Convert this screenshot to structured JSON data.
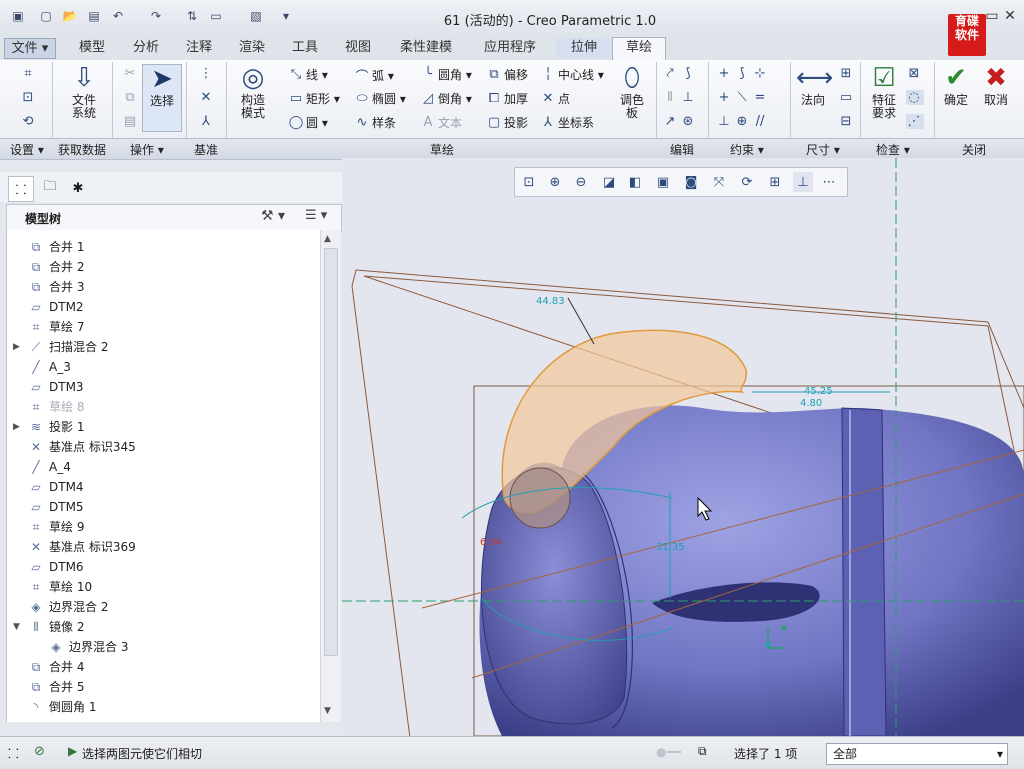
{
  "window": {
    "title": "61 (活动的) - Creo Parametric 1.0"
  },
  "logo": {
    "line1": "育碟",
    "line2": "软件"
  },
  "tabs": {
    "file": "文件",
    "items": [
      "模型",
      "分析",
      "注释",
      "渲染",
      "工具",
      "视图",
      "柔性建模",
      "应用程序"
    ],
    "extrude": "拉伸",
    "sketch": "草绘"
  },
  "ribbon": {
    "file_system": "文件\n系统",
    "select": "选择",
    "construct": "构造\n模式",
    "line": "线",
    "rectangle": "矩形",
    "circle": "圆",
    "arc": "弧",
    "ellipse": "椭圆",
    "spline": "样条",
    "fillet": "圆角",
    "chamfer": "倒角",
    "text": "文本",
    "offset": "偏移",
    "thicken": "加厚",
    "project": "投影",
    "centerline": "中心线",
    "point": "点",
    "coordsys": "坐标系",
    "palette": "调色\n板",
    "normal": "法向",
    "feature_req": "特征\n要求",
    "ok": "确定",
    "cancel": "取消"
  },
  "groups": {
    "settings": "设置",
    "get_data": "获取数据",
    "operations": "操作",
    "datum": "基准",
    "sketching": "草绘",
    "editing": "编辑",
    "constrain": "约束",
    "dimension": "尺寸",
    "inspect": "检查",
    "close": "关闭"
  },
  "model_tree": {
    "title": "模型树",
    "items": [
      {
        "label": "合并 1",
        "icon": "merge-icon"
      },
      {
        "label": "合并 2",
        "icon": "merge-icon"
      },
      {
        "label": "合并 3",
        "icon": "merge-icon"
      },
      {
        "label": "DTM2",
        "icon": "datum-plane-icon"
      },
      {
        "label": "草绘 7",
        "icon": "sketch-icon"
      },
      {
        "label": "扫描混合 2",
        "icon": "swept-blend-icon"
      },
      {
        "label": "A_3",
        "icon": "axis-icon"
      },
      {
        "label": "DTM3",
        "icon": "datum-plane-icon"
      },
      {
        "label": "草绘 8",
        "icon": "sketch-icon"
      },
      {
        "label": "投影 1",
        "icon": "projection-icon"
      },
      {
        "label": "基准点 标识345",
        "icon": "datum-point-icon"
      },
      {
        "label": "A_4",
        "icon": "axis-icon"
      },
      {
        "label": "DTM4",
        "icon": "datum-plane-icon"
      },
      {
        "label": "DTM5",
        "icon": "datum-plane-icon"
      },
      {
        "label": "草绘 9",
        "icon": "sketch-icon"
      },
      {
        "label": "基准点 标识369",
        "icon": "datum-point-icon"
      },
      {
        "label": "DTM6",
        "icon": "datum-plane-icon"
      },
      {
        "label": "草绘 10",
        "icon": "sketch-icon"
      },
      {
        "label": "边界混合 2",
        "icon": "boundary-blend-icon"
      },
      {
        "label": "镜像 2",
        "icon": "mirror-icon"
      },
      {
        "label": "边界混合 3",
        "icon": "boundary-blend-icon"
      },
      {
        "label": "合并 4",
        "icon": "merge-icon"
      },
      {
        "label": "合并 5",
        "icon": "merge-icon"
      },
      {
        "label": "倒圆角 1",
        "icon": "round-icon"
      }
    ]
  },
  "dimensions": {
    "d1": "44.83",
    "d2": "45.25",
    "d3": "31.35",
    "d4": "6.94",
    "d5": "4.80"
  },
  "status": {
    "message": "选择两图元使它们相切",
    "selected": "选择了 1 项",
    "filter": "全部"
  }
}
